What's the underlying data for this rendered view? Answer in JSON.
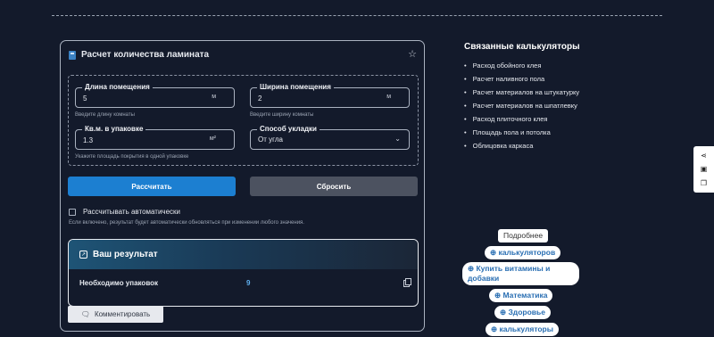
{
  "calculator": {
    "title": "Расчет количества ламината",
    "fields": {
      "length": {
        "label": "Длина помещения",
        "value": "5",
        "unit": "м",
        "hint": "Введите длину комнаты"
      },
      "width": {
        "label": "Ширина помещения",
        "value": "2",
        "unit": "м",
        "hint": "Введите ширину комнаты"
      },
      "pack_area": {
        "label": "Кв.м. в упаковке",
        "value": "1.3",
        "unit": "м²",
        "hint": "Укажите площадь покрытия в одной упаковке"
      },
      "method": {
        "label": "Способ укладки",
        "value": "От угла"
      }
    },
    "calculate_label": "Рассчитать",
    "reset_label": "Сбросить",
    "auto_label": "Рассчитывать автоматически",
    "auto_hint": "Если включено, результат будет автоматически обновляться при изменении любого значения.",
    "result": {
      "title": "Ваш результат",
      "label": "Необходимо упаковок",
      "value": "9"
    },
    "comment_label": "Комментировать"
  },
  "related": {
    "title": "Связанные калькуляторы",
    "items": [
      "Расход обойного клея",
      "Расчет наливного пола",
      "Расчет материалов на штукатурку",
      "Расчет материалов на шпатлевку",
      "Расход плиточного клея",
      "Площадь пола и потолка",
      "Облицовка каркаса"
    ]
  },
  "pills": {
    "more": "Подробнее",
    "p1": "⊕ калькуляторов",
    "p2a": "⊕ Купить витамины и",
    "p2b": "добавки",
    "p3": "⊕ Математика",
    "p4": "⊕ Здоровье",
    "p5": "⊕ калькуляторы"
  },
  "icons": {
    "share": "share-icon",
    "save": "save-icon",
    "copy": "copy-icon",
    "star": "star-icon"
  },
  "colors": {
    "background": "#131a2b",
    "primary": "#1c7fd1",
    "reset": "#4c5260",
    "result_value": "#5fb0f0"
  }
}
